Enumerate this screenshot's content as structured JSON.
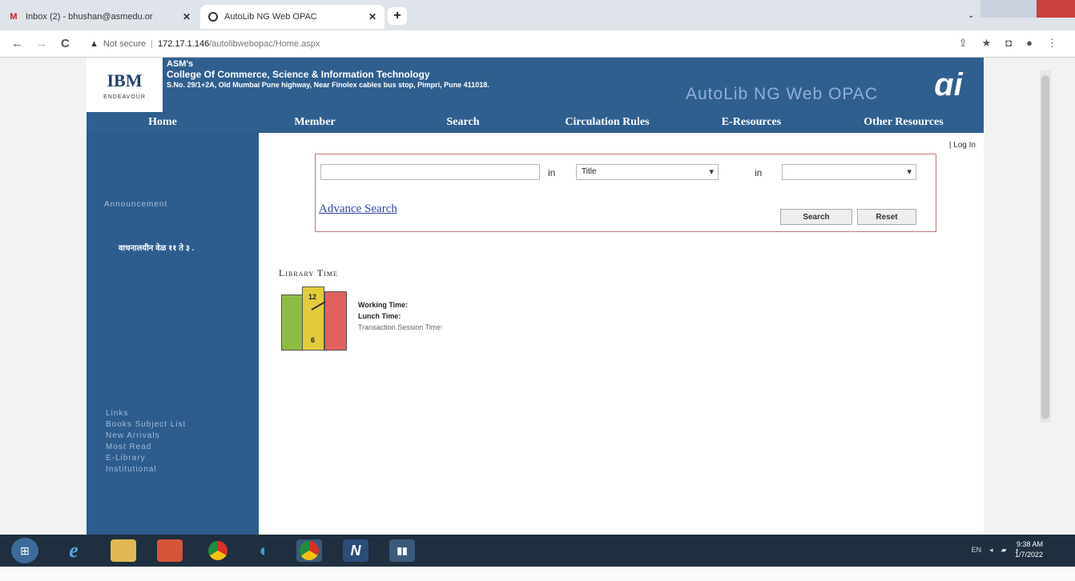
{
  "browser": {
    "tabs": [
      {
        "title": "Inbox (2) - bhushan@asmedu.or",
        "favicon": "gmail-icon"
      },
      {
        "title": "AutoLib NG Web OPAC",
        "favicon": "autolib-icon"
      }
    ],
    "new_tab_label": "+",
    "address": {
      "warning": "▲",
      "security": "Not secure",
      "separator": "|",
      "host": "172.17.1.146",
      "path": "/autolibwebopac/Home.aspx"
    }
  },
  "header": {
    "logo_mark": "IBM",
    "logo_sub": "ENDEAVOUR",
    "college_line1": "ASM's",
    "college_line2": "College Of Commerce, Science & Information Technology",
    "college_line3": "S.No. 29/1+2A, Old Mumbai Pune highway, Near Finolex cables bus stop, Pimpri, Pune 411018.",
    "opac_title": "AutoLib NG Web OPAC",
    "opac_logo": "ɑi"
  },
  "menu": {
    "home": "Home",
    "member": "Member",
    "search": "Search",
    "circulation": "Circulation Rules",
    "eresources": "E-Resources",
    "other": "Other Resources"
  },
  "sidebar": {
    "announcement": "Announcement",
    "hindi_text": "वाचनालयीन वेळ ११ ते ३ .",
    "quick_links": [
      "Links",
      "Books Subject List",
      "New Arrivals",
      "Most Read",
      "E-Library",
      "Institutional"
    ]
  },
  "content": {
    "login": "| Log In",
    "search_value": "",
    "in_label": "in",
    "field_select": "Title",
    "second_select": "",
    "advance_search": "Advance Search",
    "search_btn": "Search",
    "reset_btn": "Reset",
    "library_time": "Library Time",
    "clock_12": "12",
    "clock_6": "6",
    "working_time": "Working Time:",
    "lunch_time": "Lunch Time:",
    "session_time": "Transaction Session Time:"
  },
  "taskbar": {
    "start_label": "⊞",
    "ie_label": "e",
    "n_label": "N",
    "app_label": "▮▮",
    "tray_lang": "EN",
    "clock_time": "9:38 AM",
    "clock_date": "1/7/2022"
  }
}
